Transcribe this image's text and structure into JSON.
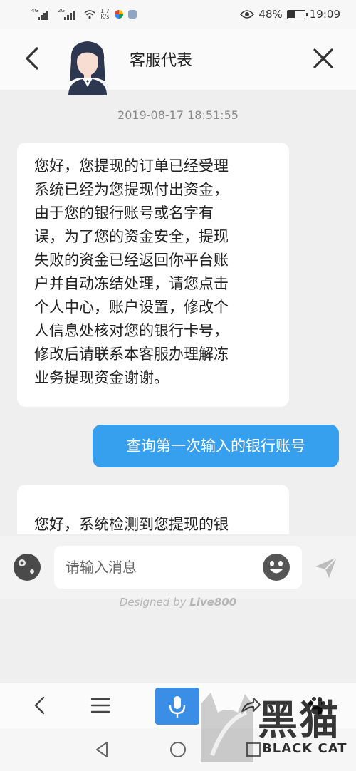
{
  "status_bar": {
    "sim1_tag": "4G",
    "sim2_tag": "2G",
    "net_speed_value": "1.7",
    "net_speed_unit": "K/s",
    "battery_percent": "48%",
    "battery_level": 0.48,
    "time": "19:09"
  },
  "header": {
    "title": "客服代表",
    "icons": [
      "back-arrow-icon",
      "agent-avatar",
      "close-icon"
    ]
  },
  "chat": {
    "timestamp": "2019-08-17 18:51:55",
    "agent_message_lines": [
      "您好，您提现的订单已经受理",
      "系统已经为您提现付出资金，",
      "由于您的银行账号或名字有",
      "误，为了您的资金安全，提现",
      "失败的资金已经返回你平台账",
      "户并自动冻结处理，请您点击",
      "个人中心，账户设置，修改个",
      "人信息处核对您的银行卡号，",
      "修改后请联系本客服办理解冻",
      "业务提现资金谢谢。"
    ],
    "user_message": "查询第一次输入的银行账号",
    "agent_message_2_partial": "您好，系统检测到您提现的银"
  },
  "input_bar": {
    "placeholder": "请输入消息",
    "icons": [
      "attach-icon",
      "emoji-icon",
      "send-icon"
    ]
  },
  "footer": {
    "designed_by": "Designed by",
    "brand": "Live800"
  },
  "browser_toolbar": {
    "icons": [
      "back-icon",
      "menu-icon",
      "microphone-icon",
      "share-icon",
      "paw-icon"
    ],
    "accent": "#3a8ee6"
  },
  "nav_bar": {
    "icons": [
      "nav-back-icon",
      "nav-home-icon",
      "nav-recents-icon"
    ]
  },
  "watermark": {
    "chinese": "黑猫",
    "english": "BLACK CAT"
  },
  "colors": {
    "user_bubble": "#37a0ee",
    "background": "#efefef",
    "agent_bubble": "#ffffff"
  }
}
